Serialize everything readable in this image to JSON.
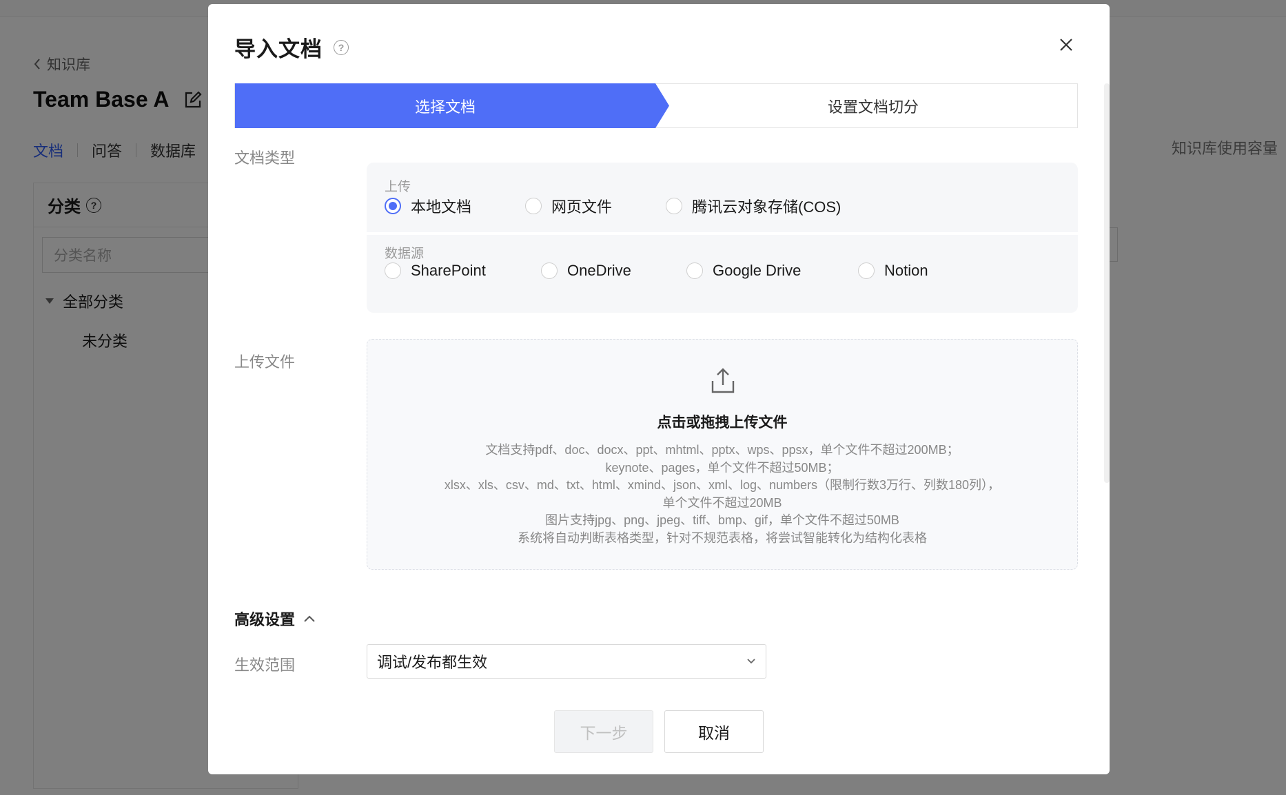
{
  "background": {
    "back_label": "知识库",
    "kb_title": "Team Base A",
    "tabs": [
      "文档",
      "问答",
      "数据库"
    ],
    "capacity_label": "知识库使用容量",
    "category_title": "分类",
    "category_search_placeholder": "分类名称",
    "tree_all": "全部分类",
    "tree_uncategorized": "未分类"
  },
  "modal": {
    "title": "导入文档",
    "steps": [
      "选择文档",
      "设置文档切分"
    ],
    "doc_type_label": "文档类型",
    "upload_group_title": "上传",
    "upload_options": [
      "本地文档",
      "网页文件",
      "腾讯云对象存储(COS)"
    ],
    "selected_upload_option": "本地文档",
    "datasource_group_title": "数据源",
    "datasource_options": [
      "SharePoint",
      "OneDrive",
      "Google Drive",
      "Notion"
    ],
    "upload_label": "上传文件",
    "upload_title": "点击或拖拽上传文件",
    "upload_desc": [
      "文档支持pdf、doc、docx、ppt、mhtml、pptx、wps、ppsx，单个文件不超过200MB；",
      "keynote、pages，单个文件不超过50MB；",
      "xlsx、xls、csv、md、txt、html、xmind、json、xml、log、numbers（限制行数3万行、列数180列），",
      "单个文件不超过20MB",
      "图片支持jpg、png、jpeg、tiff、bmp、gif，单个文件不超过50MB",
      "系统将自动判断表格类型，针对不规范表格，将尝试智能转化为结构化表格"
    ],
    "advanced_label": "高级设置",
    "scope_label": "生效范围",
    "scope_value": "调试/发布都生效",
    "next_button": "下一步",
    "cancel_button": "取消"
  },
  "colors": {
    "primary": "#4f6ef7",
    "active_tab": "#2f5df5"
  }
}
